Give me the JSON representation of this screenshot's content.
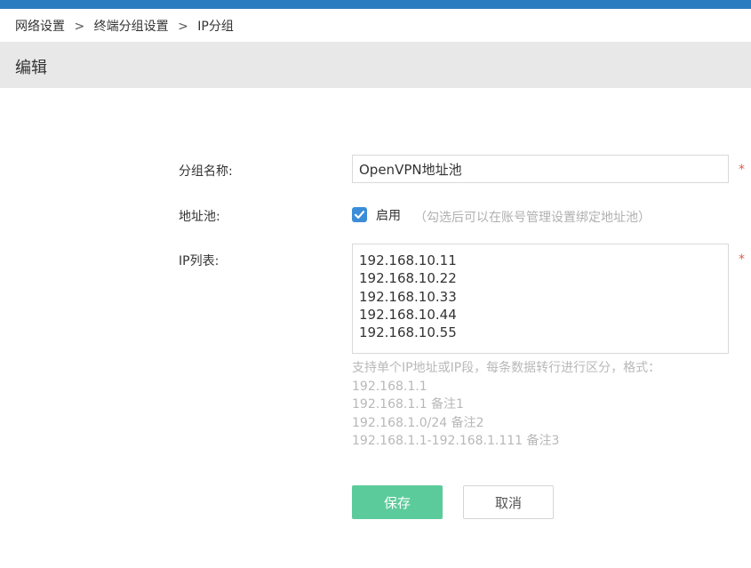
{
  "breadcrumb": {
    "items": [
      "网络设置",
      "终端分组设置",
      "IP分组"
    ],
    "separator": ">"
  },
  "header": {
    "title": "编辑"
  },
  "form": {
    "group_name": {
      "label": "分组名称:",
      "value": "OpenVPN地址池",
      "required_mark": "*"
    },
    "address_pool": {
      "label": "地址池:",
      "checked": true,
      "checkbox_label": "启用",
      "hint": "（勾选后可以在账号管理设置绑定地址池）"
    },
    "ip_list": {
      "label": "IP列表:",
      "required_mark": "*",
      "values": [
        "192.168.10.11",
        "192.168.10.22",
        "192.168.10.33",
        "192.168.10.44",
        "192.168.10.55"
      ],
      "help_lines": [
        "支持单个IP地址或IP段，每条数据转行进行区分，格式：",
        "192.168.1.1",
        "192.168.1.1 备注1",
        "192.168.1.0/24 备注2",
        "192.168.1.1-192.168.1.111 备注3"
      ]
    }
  },
  "buttons": {
    "save": "保存",
    "cancel": "取消"
  },
  "colors": {
    "topbar": "#2a7cc0",
    "header_bg": "#e8e8e8",
    "checkbox": "#3c8dd8",
    "save_button": "#5ccb9b",
    "required": "#e05a4f"
  }
}
